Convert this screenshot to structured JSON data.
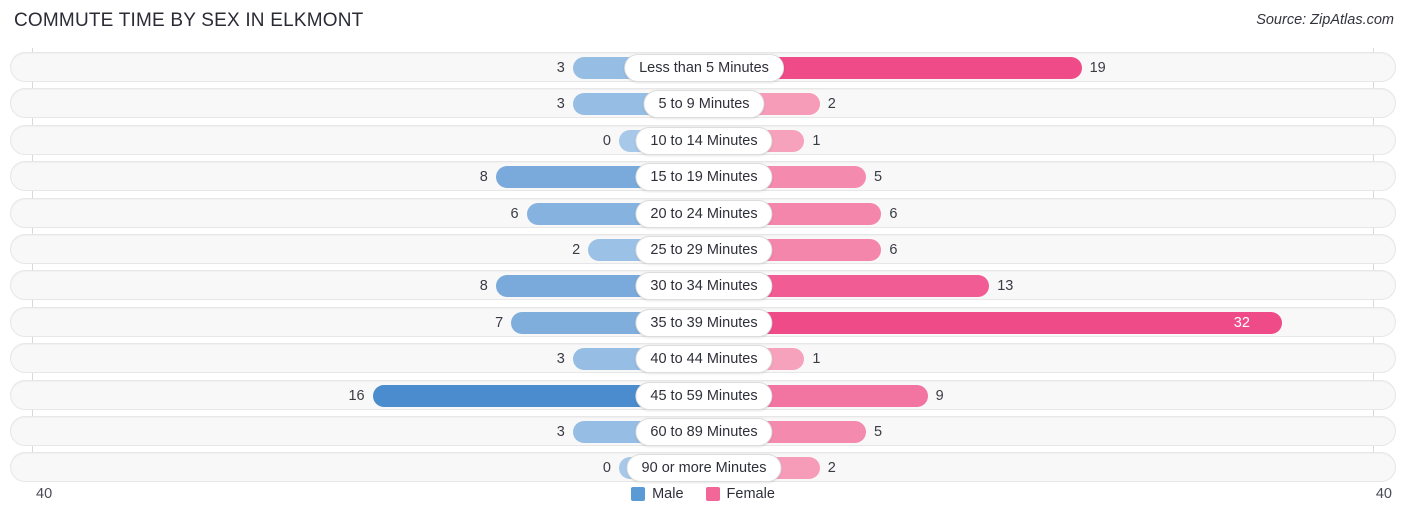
{
  "header": {
    "title": "COMMUTE TIME BY SEX IN ELKMONT",
    "source": "Source: ZipAtlas.com"
  },
  "legend": {
    "items": [
      {
        "label": "Male",
        "color": "#5b9bd5"
      },
      {
        "label": "Female",
        "color": "#f26698"
      }
    ]
  },
  "axis": {
    "left_tick": "40",
    "right_tick": "40",
    "max": 40
  },
  "chart_data": {
    "type": "bar",
    "orientation": "horizontal-diverging",
    "title": "COMMUTE TIME BY SEX IN ELKMONT",
    "xlabel": "",
    "ylabel": "",
    "xlim": [
      40,
      40
    ],
    "grid": false,
    "legend_position": "bottom-center",
    "categories": [
      "Less than 5 Minutes",
      "5 to 9 Minutes",
      "10 to 14 Minutes",
      "15 to 19 Minutes",
      "20 to 24 Minutes",
      "25 to 29 Minutes",
      "30 to 34 Minutes",
      "35 to 39 Minutes",
      "40 to 44 Minutes",
      "45 to 59 Minutes",
      "60 to 89 Minutes",
      "90 or more Minutes"
    ],
    "series": [
      {
        "name": "Male",
        "values": [
          3,
          3,
          0,
          8,
          6,
          2,
          8,
          7,
          3,
          16,
          3,
          0
        ]
      },
      {
        "name": "Female",
        "values": [
          19,
          2,
          1,
          5,
          6,
          6,
          13,
          32,
          1,
          9,
          5,
          2
        ]
      }
    ]
  },
  "rows": [
    {
      "category": "Less than 5 Minutes",
      "male": "3",
      "female": "19",
      "male_v": 3,
      "female_v": 19
    },
    {
      "category": "5 to 9 Minutes",
      "male": "3",
      "female": "2",
      "male_v": 3,
      "female_v": 2
    },
    {
      "category": "10 to 14 Minutes",
      "male": "0",
      "female": "1",
      "male_v": 0,
      "female_v": 1
    },
    {
      "category": "15 to 19 Minutes",
      "male": "8",
      "female": "5",
      "male_v": 8,
      "female_v": 5
    },
    {
      "category": "20 to 24 Minutes",
      "male": "6",
      "female": "6",
      "male_v": 6,
      "female_v": 6
    },
    {
      "category": "25 to 29 Minutes",
      "male": "2",
      "female": "6",
      "male_v": 2,
      "female_v": 6
    },
    {
      "category": "30 to 34 Minutes",
      "male": "8",
      "female": "13",
      "male_v": 8,
      "female_v": 13
    },
    {
      "category": "35 to 39 Minutes",
      "male": "7",
      "female": "32",
      "male_v": 7,
      "female_v": 32
    },
    {
      "category": "40 to 44 Minutes",
      "male": "3",
      "female": "1",
      "male_v": 3,
      "female_v": 1
    },
    {
      "category": "45 to 59 Minutes",
      "male": "16",
      "female": "9",
      "male_v": 16,
      "female_v": 9
    },
    {
      "category": "60 to 89 Minutes",
      "male": "3",
      "female": "5",
      "male_v": 3,
      "female_v": 5
    },
    {
      "category": "90 or more Minutes",
      "male": "0",
      "female": "2",
      "male_v": 0,
      "female_v": 2
    }
  ]
}
